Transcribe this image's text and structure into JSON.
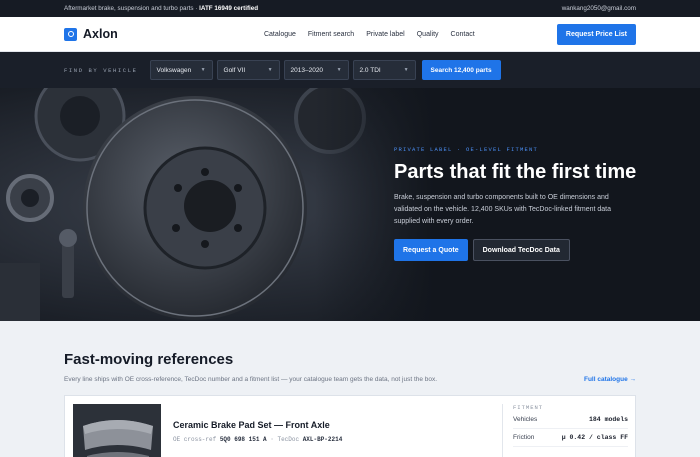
{
  "topbar": {
    "tagline": "Aftermarket brake, suspension and turbo parts ·",
    "cert": "IATF 16949 certified",
    "email": "wankang2050@gmail.com"
  },
  "header": {
    "brand": "Axlon",
    "nav": [
      "Catalogue",
      "Fitment search",
      "Private label",
      "Quality",
      "Contact"
    ],
    "cta": "Request Price List"
  },
  "finder": {
    "label": "FIND BY VEHICLE",
    "make": "Volkswagen",
    "model": "Golf VII",
    "years": "2013–2020",
    "engine": "2.0 TDI",
    "search": "Search 12,400 parts"
  },
  "hero": {
    "eyebrow": "PRIVATE LABEL · OE-LEVEL FITMENT",
    "title": "Parts that fit the first time",
    "subtitle": "Brake, suspension and turbo components built to OE dimensions and validated on the vehicle. 12,400 SKUs with TecDoc-linked fitment data supplied with every order.",
    "primary": "Request a Quote",
    "secondary": "Download TecDoc Data"
  },
  "refs": {
    "title": "Fast-moving references",
    "subtitle": "Every line ships with OE cross-reference, TecDoc number and a fitment list — your catalogue team gets the data, not just the box.",
    "link": "Full catalogue →",
    "card": {
      "title": "Ceramic Brake Pad Set — Front Axle",
      "oe_label": "OE cross-ref",
      "oe_value": "5Q0 698 151 A",
      "sep": "·",
      "tecdoc_label": "TecDoc",
      "tecdoc_value": "AXL-BP-2214",
      "specs_title": "FITMENT",
      "specs": [
        {
          "k": "Vehicles",
          "v": "184 models"
        },
        {
          "k": "Friction",
          "v": "μ 0.42 / class FF"
        }
      ]
    }
  }
}
